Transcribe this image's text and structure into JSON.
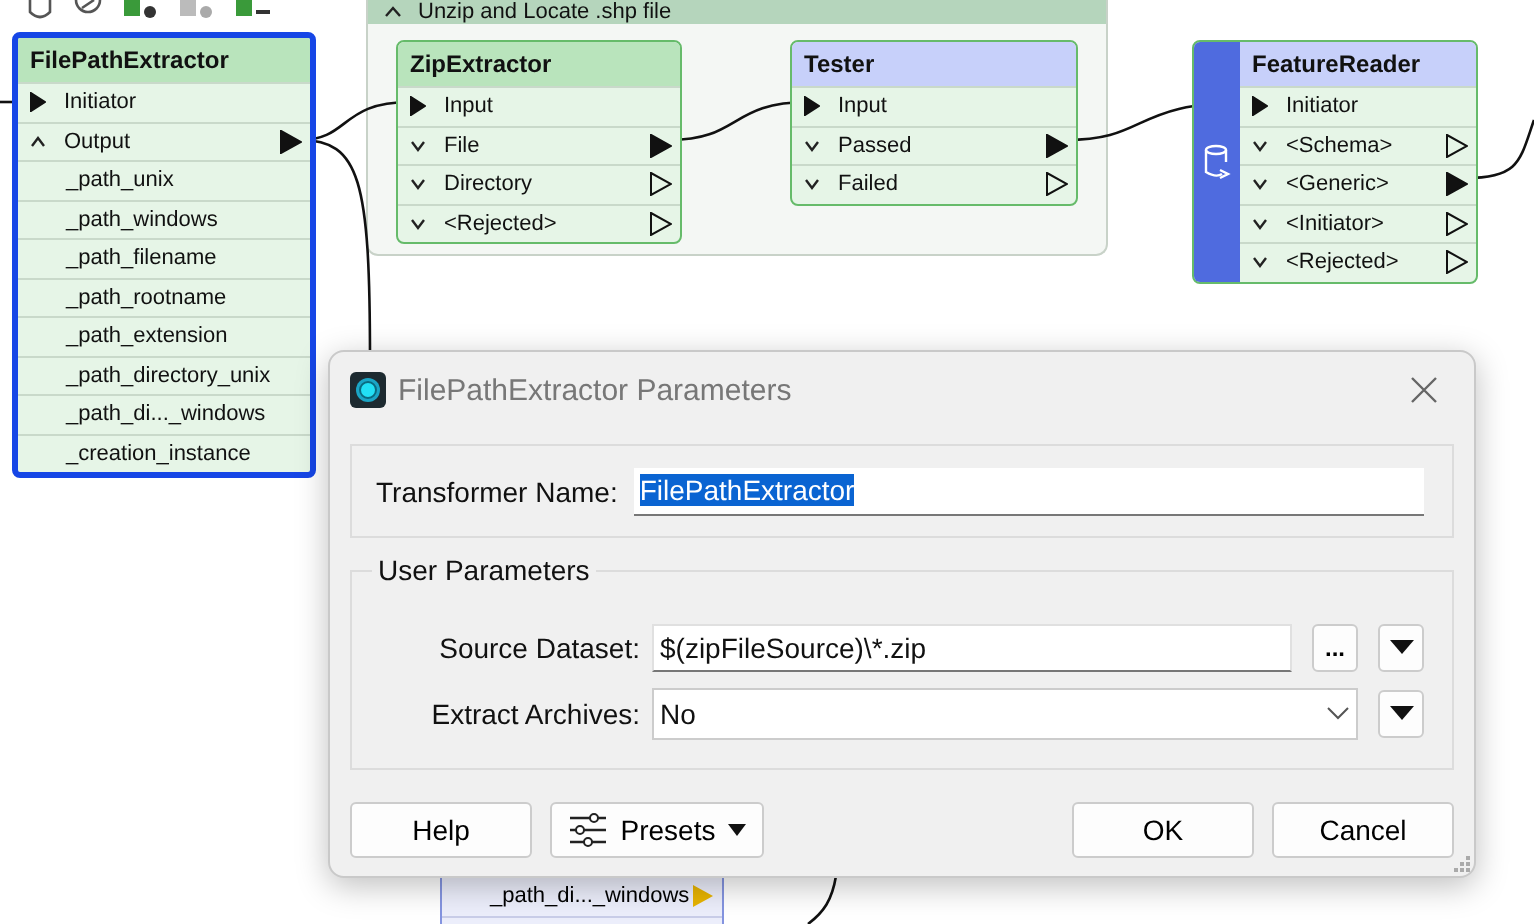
{
  "bookmark": {
    "title": "Unzip and Locate .shp file",
    "expanded": true
  },
  "transformers": [
    {
      "name": "FilePathExtractor",
      "kind": "transformer",
      "color": "#b9e4bc",
      "selected": true,
      "ports": [
        {
          "kind": "input",
          "label": "Initiator",
          "connected": true
        },
        {
          "kind": "output",
          "label": "Output",
          "expanded": true,
          "connected": true
        },
        {
          "kind": "attribute",
          "label": "_path_unix"
        },
        {
          "kind": "attribute",
          "label": "_path_windows"
        },
        {
          "kind": "attribute",
          "label": "_path_filename"
        },
        {
          "kind": "attribute",
          "label": "_path_rootname"
        },
        {
          "kind": "attribute",
          "label": "_path_extension"
        },
        {
          "kind": "attribute",
          "label": "_path_directory_unix"
        },
        {
          "kind": "attribute",
          "label": "_path_di..._windows"
        },
        {
          "kind": "attribute",
          "label": "_creation_instance"
        }
      ]
    },
    {
      "name": "ZipExtractor",
      "kind": "transformer",
      "color": "#b9e4bc",
      "selected": false,
      "ports": [
        {
          "kind": "input",
          "label": "Input",
          "connected": true
        },
        {
          "kind": "output",
          "label": "File",
          "expanded": false,
          "connected": true
        },
        {
          "kind": "output",
          "label": "Directory",
          "expanded": false,
          "connected": false
        },
        {
          "kind": "output",
          "label": "<Rejected>",
          "expanded": false,
          "connected": false
        }
      ]
    },
    {
      "name": "Tester",
      "kind": "transformer",
      "color": "#c7d0fa",
      "selected": false,
      "ports": [
        {
          "kind": "input",
          "label": "Input",
          "connected": true
        },
        {
          "kind": "output",
          "label": "Passed",
          "expanded": false,
          "connected": true
        },
        {
          "kind": "output",
          "label": "Failed",
          "expanded": false,
          "connected": false
        }
      ]
    },
    {
      "name": "FeatureReader",
      "kind": "reader",
      "color": "#c7d0fa",
      "selected": false,
      "ports": [
        {
          "kind": "input",
          "label": "Initiator",
          "connected": true
        },
        {
          "kind": "output",
          "label": "<Schema>",
          "expanded": false,
          "connected": false
        },
        {
          "kind": "output",
          "label": "<Generic>",
          "expanded": false,
          "connected": true
        },
        {
          "kind": "output",
          "label": "<Initiator>",
          "expanded": false,
          "connected": false
        },
        {
          "kind": "output",
          "label": "<Rejected>",
          "expanded": false,
          "connected": false
        }
      ]
    }
  ],
  "partial_node": {
    "ports": [
      {
        "kind": "exposed",
        "label": "_path_di..._windows"
      }
    ]
  },
  "dialog": {
    "title": "FilePathExtractor Parameters",
    "transformer_name": {
      "label": "Transformer Name:",
      "value": "FilePathExtractor",
      "text_selected": true
    },
    "group_title": "User Parameters",
    "parameters": [
      {
        "kind": "text",
        "label": "Source Dataset:",
        "value": "$(zipFileSource)\\*.zip",
        "browse": "..."
      },
      {
        "kind": "choice",
        "label": "Extract Archives:",
        "value": "No"
      }
    ],
    "buttons": [
      {
        "kind": "plain",
        "label": "Help"
      },
      {
        "kind": "menu",
        "label": "Presets"
      },
      {
        "kind": "plain",
        "label": "OK"
      },
      {
        "kind": "plain",
        "label": "Cancel"
      }
    ]
  }
}
